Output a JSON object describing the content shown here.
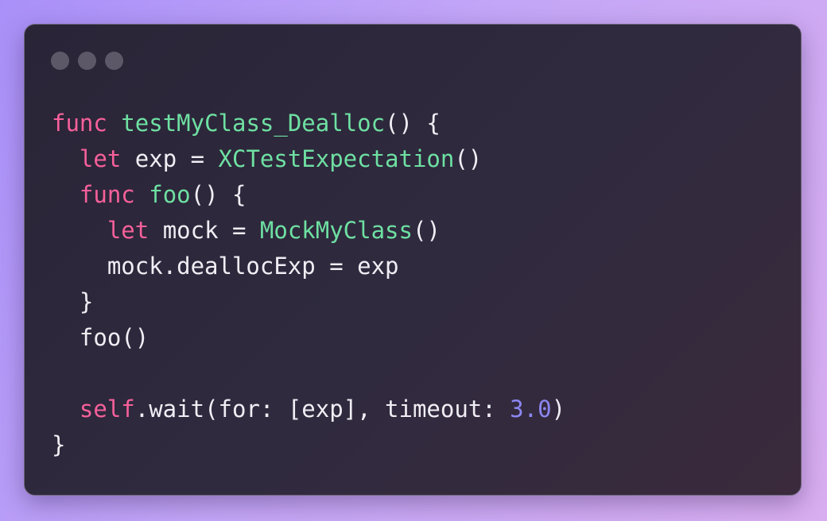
{
  "code_lines": [
    [
      {
        "t": "func",
        "c": "kw"
      },
      {
        "t": " ",
        "c": "pl"
      },
      {
        "t": "testMyClass_Dealloc",
        "c": "fn"
      },
      {
        "t": "() {",
        "c": "pl"
      }
    ],
    [
      {
        "t": "  ",
        "c": "pl"
      },
      {
        "t": "let",
        "c": "kw"
      },
      {
        "t": " exp = ",
        "c": "pl"
      },
      {
        "t": "XCTestExpectation",
        "c": "fn"
      },
      {
        "t": "()",
        "c": "pl"
      }
    ],
    [
      {
        "t": "  ",
        "c": "pl"
      },
      {
        "t": "func",
        "c": "kw"
      },
      {
        "t": " ",
        "c": "pl"
      },
      {
        "t": "foo",
        "c": "fn"
      },
      {
        "t": "() {",
        "c": "pl"
      }
    ],
    [
      {
        "t": "    ",
        "c": "pl"
      },
      {
        "t": "let",
        "c": "kw"
      },
      {
        "t": " mock = ",
        "c": "pl"
      },
      {
        "t": "MockMyClass",
        "c": "fn"
      },
      {
        "t": "()",
        "c": "pl"
      }
    ],
    [
      {
        "t": "    mock.deallocExp = exp",
        "c": "pl"
      }
    ],
    [
      {
        "t": "  }",
        "c": "pl"
      }
    ],
    [
      {
        "t": "  foo()",
        "c": "pl"
      }
    ],
    [
      {
        "t": "",
        "c": "pl"
      }
    ],
    [
      {
        "t": "  ",
        "c": "pl"
      },
      {
        "t": "self",
        "c": "kw"
      },
      {
        "t": ".wait(for: [exp], timeout: ",
        "c": "pl"
      },
      {
        "t": "3.0",
        "c": "num"
      },
      {
        "t": ")",
        "c": "pl"
      }
    ],
    [
      {
        "t": "}",
        "c": "pl"
      }
    ]
  ],
  "colors": {
    "keyword": "#f6609a",
    "function": "#6ee0a2",
    "number": "#8b87f2",
    "plain": "#f0eef4",
    "window_bg": "#2a2437",
    "window_dot": "#5d5868"
  }
}
